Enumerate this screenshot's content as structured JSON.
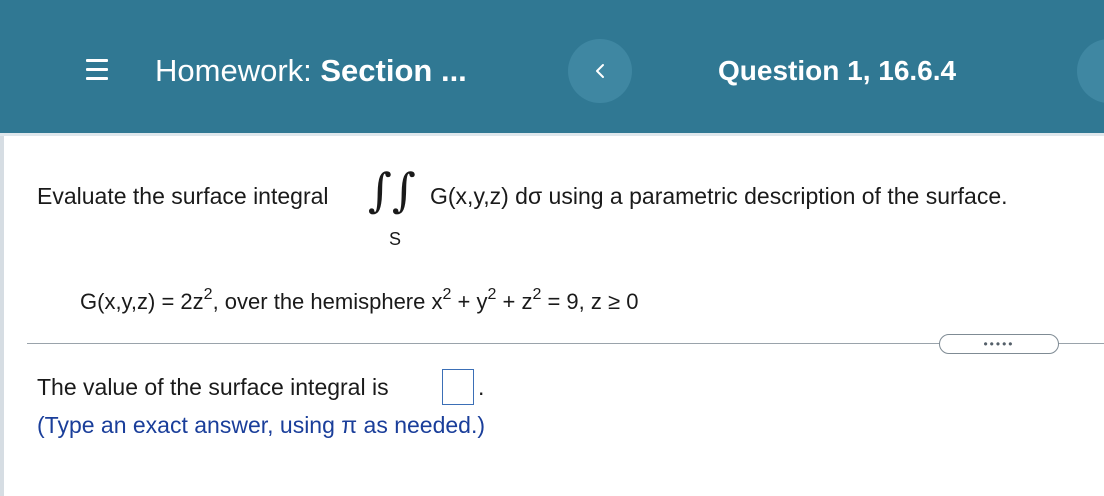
{
  "header": {
    "menu_icon": "hamburger-menu-icon",
    "title_prefix": "Homework: ",
    "title_section": "Section ...",
    "prev_icon": "chevron-left-icon",
    "question_label": "Question 1, 16.6.4",
    "background_color": "#307893"
  },
  "problem": {
    "instruction_start": "Evaluate the surface integral",
    "integral_symbol": "∫∫",
    "integral_subscript": "S",
    "instruction_end": "G(x,y,z) dσ using a parametric description of the surface.",
    "given_part1": "G(x,y,z) = 2z",
    "given_exp1": "2",
    "given_part2": ", over the hemisphere x",
    "given_exp2": "2",
    "given_part3": " + y",
    "given_exp3": "2",
    "given_part4": " + z",
    "given_exp4": "2",
    "given_part5": " = 9, z ≥ 0"
  },
  "more_button": {
    "label": "•••••"
  },
  "answer": {
    "prompt": "The value of the surface integral is",
    "value": "",
    "period": ".",
    "hint": "(Type an exact answer, using π as needed.)",
    "hint_color": "#1a3e9a"
  }
}
